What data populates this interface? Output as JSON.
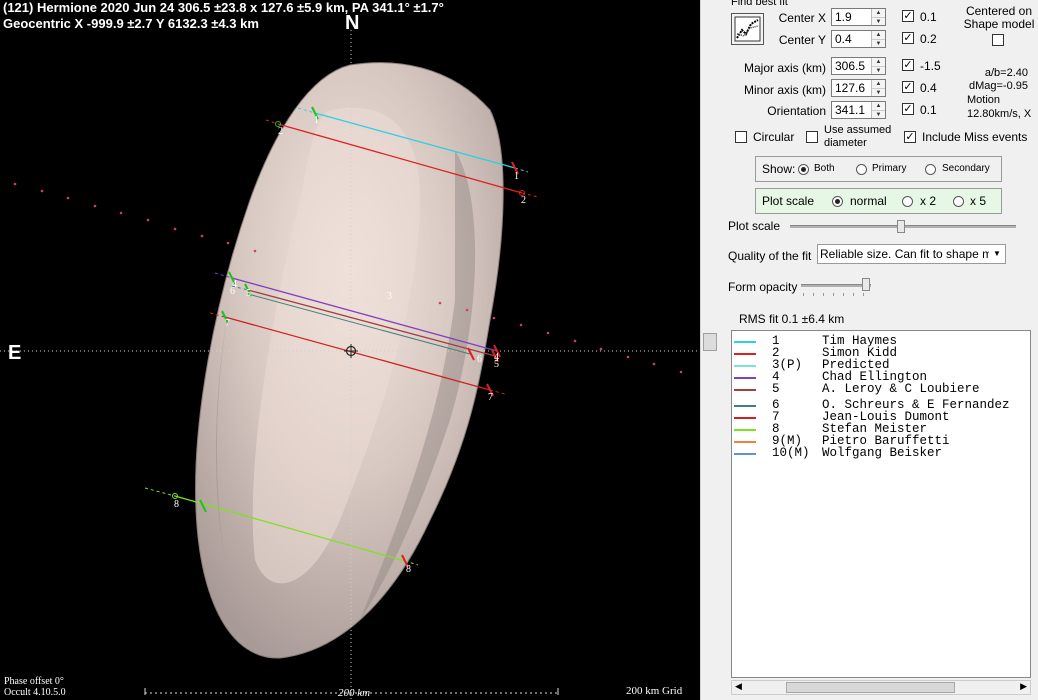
{
  "plot": {
    "header_line1": "(121) Hermione  2020 Jun 24   306.5 ±23.8 x 127.6 ±5.9 km, PA 341.1° ±1.7°",
    "header_line2": "Geocentric  X  -999.9 ±2.7  Y 6132.3 ±4.3 km",
    "north_label": "N",
    "east_label": "E",
    "phase_offset": "Phase offset 0°",
    "version": "Occult 4.10.5.0",
    "scale_label": "200 km",
    "grid_label": "200 km Grid",
    "chord_labels": [
      "1",
      "1",
      "2",
      "2",
      "3",
      "4",
      "4",
      "5",
      "5",
      "6",
      "6",
      "7",
      "7",
      "8",
      "8"
    ]
  },
  "panel": {
    "find_best_fit": "Find best fit",
    "center_x_label": "Center X",
    "center_x_value": "1.9",
    "center_x_step": "0.1",
    "center_y_label": "Center Y",
    "center_y_value": "0.4",
    "center_y_step": "0.2",
    "centered_on_label": "Centered on Shape model",
    "major_label": "Major axis (km)",
    "major_value": "306.5",
    "major_step": "-1.5",
    "minor_label": "Minor axis (km)",
    "minor_value": "127.6",
    "minor_step": "0.4",
    "orient_label": "Orientation",
    "orient_value": "341.1",
    "orient_step": "0.1",
    "ab_ratio": "a/b=2.40",
    "dmag": "dMag=-0.95",
    "motion_label": "Motion",
    "motion_value": "12.80km/s, X",
    "circular_label": "Circular",
    "use_assumed_label": "Use assumed diameter",
    "include_miss_label": "Include Miss events",
    "show_label": "Show:",
    "show_options": [
      "Both",
      "Primary",
      "Secondary"
    ],
    "plot_scale_group_label": "Plot scale",
    "plot_scale_options": [
      "normal",
      "x 2",
      "x 5"
    ],
    "plot_scale_slider_label": "Plot scale",
    "quality_label": "Quality of the fit",
    "quality_value": "Reliable size. Can fit to shape mode",
    "form_opacity_label": "Form opacity",
    "rms_label": "RMS fit 0.1 ±6.4 km"
  },
  "legend": [
    {
      "num": "1",
      "name": "Tim Haymes",
      "color": "#2fd0e0"
    },
    {
      "num": "2",
      "name": "Simon Kidd",
      "color": "#e02020"
    },
    {
      "num": "3(P)",
      "name": "Predicted",
      "color": "#80e0e0"
    },
    {
      "num": "4",
      "name": "Chad Ellington",
      "color": "#8040c0"
    },
    {
      "num": "5",
      "name": "A. Leroy & C Loubiere",
      "color": "#a04040"
    },
    {
      "num": "6",
      "name": "O. Schreurs & E Fernandez",
      "color": "#408080"
    },
    {
      "num": "7",
      "name": "Jean-Louis Dumont",
      "color": "#d02020"
    },
    {
      "num": "8",
      "name": "Stefan Meister",
      "color": "#80e020"
    },
    {
      "num": "9(M)",
      "name": "Pietro Baruffetti",
      "color": "#f08040"
    },
    {
      "num": "10(M)",
      "name": "Wolfgang Beisker",
      "color": "#6090e0"
    }
  ]
}
